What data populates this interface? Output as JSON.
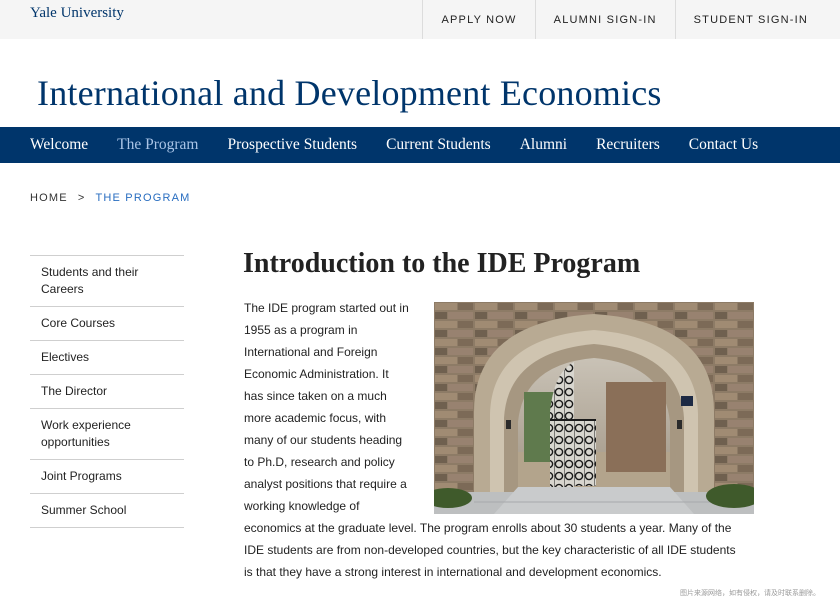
{
  "topbar": {
    "logo": "Yale University",
    "links": [
      "APPLY NOW",
      "ALUMNI SIGN-IN",
      "STUDENT SIGN-IN"
    ]
  },
  "site": {
    "title": "International and Development Economics"
  },
  "nav": {
    "items": [
      "Welcome",
      "The Program",
      "Prospective Students",
      "Current Students",
      "Alumni",
      "Recruiters",
      "Contact Us"
    ],
    "active": "The Program"
  },
  "breadcrumb": {
    "home": "HOME",
    "separator": ">",
    "current": "THE PROGRAM"
  },
  "sidebar": {
    "items": [
      "Students and their Careers",
      "Core Courses",
      "Electives",
      "The Director",
      "Work experience opportunities",
      "Joint Programs",
      "Summer School"
    ]
  },
  "content": {
    "heading": "Introduction to the IDE Program",
    "paragraph_narrow": "The IDE program started out in 1955 as a program in International and Foreign Economic Administration. It has since taken on a much more academic focus, with many of our students heading to Ph.D, research and policy analyst positions that require a working knowledge of",
    "paragraph_wide": "economics at the graduate level. The program enrolls about 30 students a year. Many of the IDE students are from non-developed countries, but the key characteristic of all IDE students is that they have a strong interest in international and development economics.",
    "photo_alt": "Gothic stone archway with wrought iron gate"
  },
  "watermark": "图片来源网络，如有侵权，请及时联系删除。",
  "colors": {
    "yale_blue": "#00356b",
    "nav_active": "#a9c4e6",
    "breadcrumb_current": "#286dc0",
    "topbar_bg": "#f5f5f5"
  },
  "icons": []
}
